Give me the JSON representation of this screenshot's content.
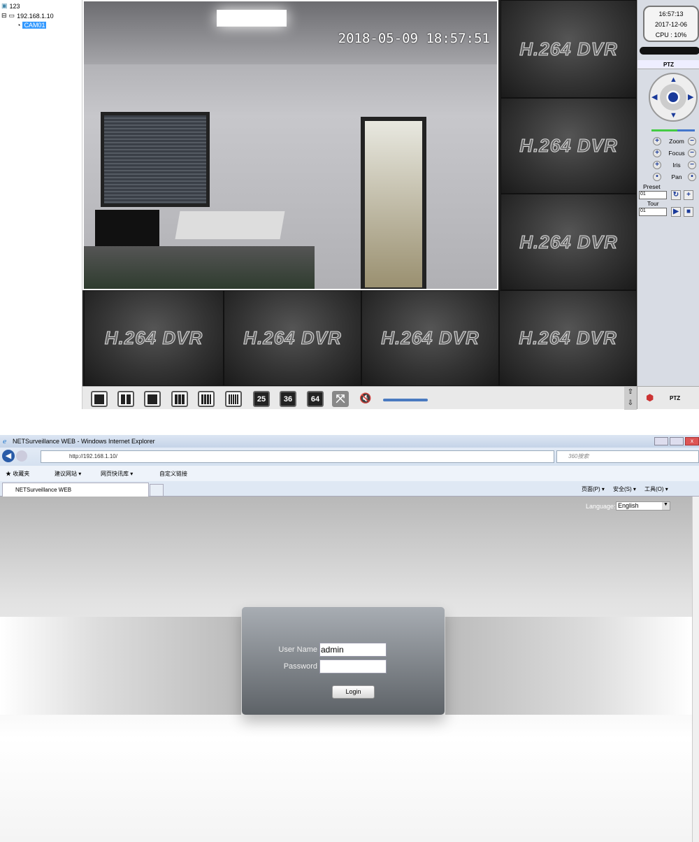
{
  "tree": {
    "root": "123",
    "device": "192.168.1.10",
    "camera": "CAM01"
  },
  "video": {
    "timestamp": "2018-05-09 18:57:51",
    "placeholder": "H.264 DVR"
  },
  "toolbar": {
    "buttons": [
      {
        "name": "1-split"
      },
      {
        "name": "4-split"
      },
      {
        "name": "6-split"
      },
      {
        "name": "9-split"
      },
      {
        "name": "8-split"
      },
      {
        "name": "16-split"
      },
      {
        "name": "25",
        "label": "25"
      },
      {
        "name": "36",
        "label": "36"
      },
      {
        "name": "64",
        "label": "64"
      },
      {
        "name": "fullscreen"
      }
    ],
    "volume": 0.05,
    "ptz_label": "PTZ"
  },
  "panel": {
    "time": "16:57:13",
    "date": "2017-12-06",
    "cpu": "CPU : 10%",
    "ptz_title": "PTZ",
    "speed": 0.6,
    "controls": [
      "Zoom",
      "Focus",
      "Iris",
      "Pan"
    ],
    "preset_label": "Preset",
    "preset_value": "01",
    "tour_label": "Tour",
    "tour_value": "01"
  },
  "ie": {
    "title": "NETSurveillance WEB - Windows Internet Explorer",
    "url": "http://192.168.1.10/",
    "search_placeholder": "360搜索",
    "favorites": [
      "收藏夹",
      "建议网站 ▾",
      "网页快讯库 ▾",
      "自定义链接"
    ],
    "tab": "NETSurveillance WEB",
    "menu": [
      "页面(P) ▾",
      "安全(S) ▾",
      "工具(O) ▾"
    ]
  },
  "login": {
    "language_label": "Language:",
    "language": "English",
    "username_label": "User Name",
    "username": "admin",
    "password_label": "Password",
    "password": "",
    "button": "Login"
  },
  "colors": {
    "selection": "#3399ff",
    "ptz_blue": "#1a3a9a"
  }
}
